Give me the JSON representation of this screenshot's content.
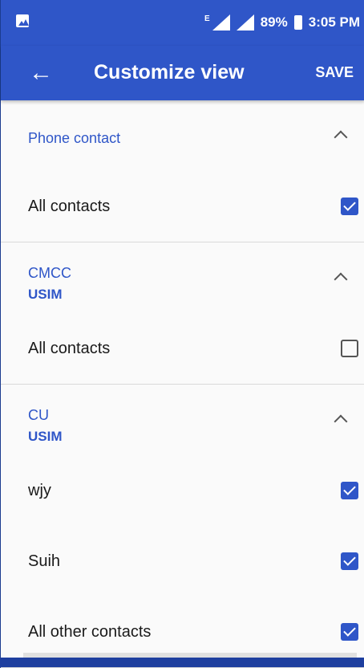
{
  "status": {
    "network_badge": "E",
    "battery_percent": "89%",
    "time": "3:05 PM"
  },
  "appbar": {
    "title": "Customize view",
    "save_label": "SAVE"
  },
  "groups": [
    {
      "title": "Phone contact",
      "subtitle": "",
      "items": [
        {
          "label": "All contacts",
          "checked": true
        }
      ]
    },
    {
      "title": "CMCC",
      "subtitle": "USIM",
      "items": [
        {
          "label": "All contacts",
          "checked": false
        }
      ]
    },
    {
      "title": "CU",
      "subtitle": "USIM",
      "items": [
        {
          "label": "wjy",
          "checked": true
        },
        {
          "label": "Suih",
          "checked": true
        },
        {
          "label": "All other contacts",
          "checked": true
        }
      ]
    }
  ],
  "icons": {
    "back": "arrow-left",
    "expand": "chevron-up",
    "status_left": "image-notification"
  },
  "colors": {
    "primary": "#2f56c8",
    "background": "#fafafa",
    "divider": "#d9d9d9"
  }
}
